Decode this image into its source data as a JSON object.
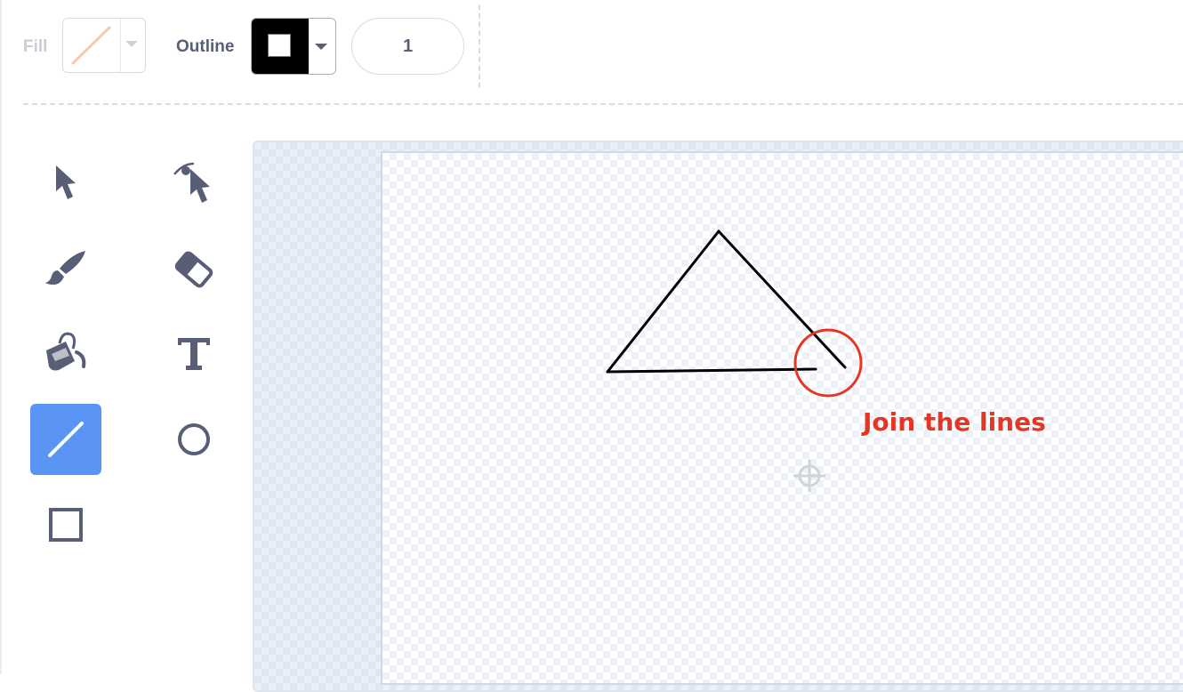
{
  "toolbar": {
    "fill_label": "Fill",
    "outline_label": "Outline",
    "outline_width": "1",
    "fill_color": "#f9c8b0",
    "outline_color": "#000000"
  },
  "tools": [
    {
      "name": "select",
      "icon": "arrow-pointer-icon",
      "active": false
    },
    {
      "name": "reshape",
      "icon": "reshape-pointer-icon",
      "active": false
    },
    {
      "name": "brush",
      "icon": "brush-icon",
      "active": false
    },
    {
      "name": "eraser",
      "icon": "eraser-icon",
      "active": false
    },
    {
      "name": "fill",
      "icon": "paint-bucket-icon",
      "active": false
    },
    {
      "name": "text",
      "icon": "text-t-icon",
      "active": false
    },
    {
      "name": "line",
      "icon": "line-icon",
      "active": true
    },
    {
      "name": "circle",
      "icon": "circle-icon",
      "active": false
    },
    {
      "name": "rectangle",
      "icon": "rectangle-icon",
      "active": false
    }
  ],
  "canvas": {
    "annotation": "Join the lines",
    "annotation_color": "#e53524",
    "accent_color": "#5a94f5"
  }
}
